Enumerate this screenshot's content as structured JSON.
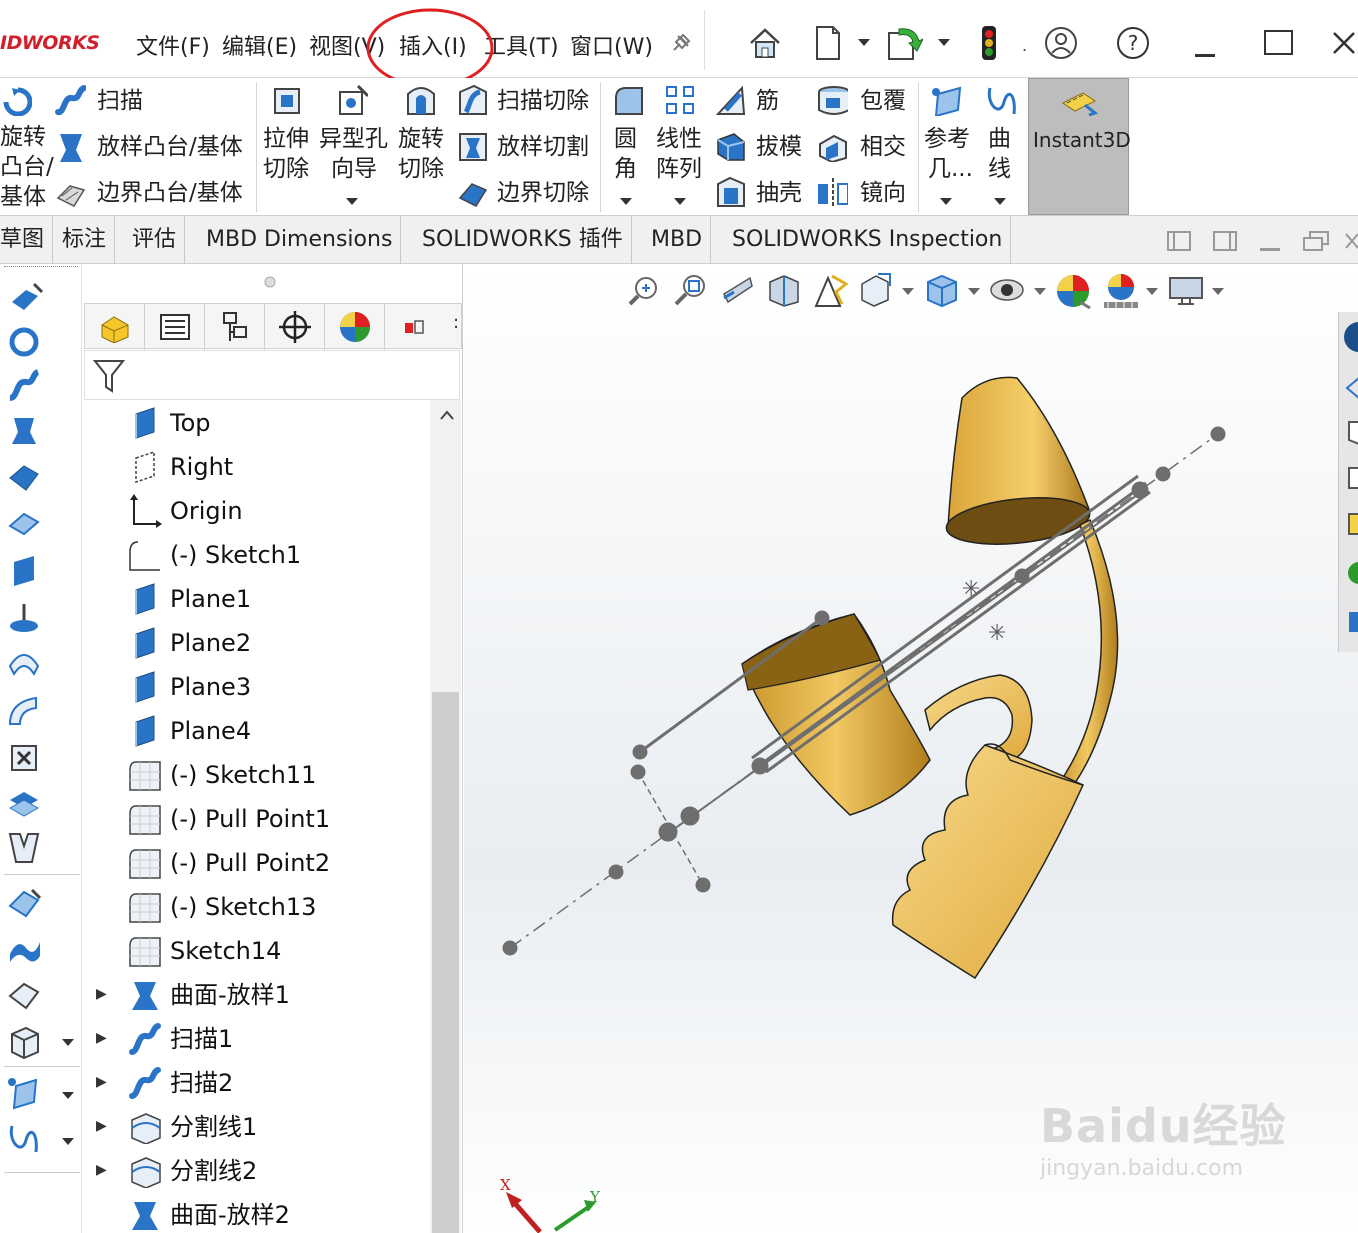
{
  "app": {
    "logo": "IDWORKS"
  },
  "menu": {
    "file": "文件(F)",
    "edit": "编辑(E)",
    "view": "视图(V)",
    "insert": "插入(I)",
    "tools": "工具(T)",
    "window": "窗口(W)"
  },
  "icons": {
    "home": "home-icon",
    "new": "new-document-icon",
    "rebuild": "rebuild-icon",
    "traffic": "traffic-light-icon",
    "user": "user-icon",
    "help": "help-icon",
    "minimize": "minimize-icon",
    "maximize": "maximize-icon",
    "close": "close-icon",
    "pin": "pin-icon"
  },
  "ribbon": {
    "revolve_l1": "旋转",
    "revolve_l2": "凸台/",
    "revolve_l3": "基体",
    "sweep": "扫描",
    "loft": "放样凸台/基体",
    "boundary": "边界凸台/基体",
    "extcut_l1": "拉伸",
    "extcut_l2": "切除",
    "hole_l1": "异型孔",
    "hole_l2": "向导",
    "revcut_l1": "旋转",
    "revcut_l2": "切除",
    "sweepcut": "扫描切除",
    "loftcut": "放样切割",
    "boundcut": "边界切除",
    "fillet_l1": "圆",
    "fillet_l2": "角",
    "pattern_l1": "线性",
    "pattern_l2": "阵列",
    "rib": "筋",
    "draft": "拔模",
    "shell": "抽壳",
    "wrap": "包覆",
    "intersect": "相交",
    "mirror": "镜向",
    "refgeo_l1": "参考",
    "refgeo_l2": "几...",
    "curves_l1": "曲",
    "curves_l2": "线",
    "instant3d": "Instant3D"
  },
  "tabs": [
    "草图",
    "标注",
    "评估",
    "MBD Dimensions",
    "SOLIDWORKS 插件",
    "MBD",
    "SOLIDWORKS Inspection"
  ],
  "tree": [
    {
      "label": "Top",
      "icon": "plane-icon",
      "expand": false
    },
    {
      "label": "Right",
      "icon": "plane-outline-icon",
      "expand": false
    },
    {
      "label": "Origin",
      "icon": "origin-icon",
      "expand": false
    },
    {
      "label": "(-) Sketch1",
      "icon": "sketch-icon",
      "expand": false
    },
    {
      "label": "Plane1",
      "icon": "plane-icon",
      "expand": false
    },
    {
      "label": "Plane2",
      "icon": "plane-icon",
      "expand": false
    },
    {
      "label": "Plane3",
      "icon": "plane-icon",
      "expand": false
    },
    {
      "label": "Plane4",
      "icon": "plane-icon",
      "expand": false
    },
    {
      "label": "(-) Sketch11",
      "icon": "sketch-grid-icon",
      "expand": false
    },
    {
      "label": "(-) Pull Point1",
      "icon": "sketch-grid-icon",
      "expand": false
    },
    {
      "label": "(-) Pull Point2",
      "icon": "sketch-grid-icon",
      "expand": false
    },
    {
      "label": "(-) Sketch13",
      "icon": "sketch-grid-icon",
      "expand": false
    },
    {
      "label": "Sketch14",
      "icon": "sketch-grid-icon",
      "expand": false
    },
    {
      "label": "曲面-放样1",
      "icon": "loft-surface-icon",
      "expand": true
    },
    {
      "label": "扫描1",
      "icon": "sweep-icon",
      "expand": true
    },
    {
      "label": "扫描2",
      "icon": "sweep-icon",
      "expand": true
    },
    {
      "label": "分割线1",
      "icon": "split-line-icon",
      "expand": true
    },
    {
      "label": "分割线2",
      "icon": "split-line-icon",
      "expand": true
    },
    {
      "label": "曲面-放样2",
      "icon": "loft-surface-icon",
      "expand": false
    }
  ],
  "triad": {
    "x": "X",
    "y": "Y"
  },
  "watermark": {
    "line1": "Baidu经验",
    "line2": "jingyan.baidu.com"
  },
  "colors": {
    "accent": "#d0202c",
    "part": "#e8b94a",
    "annotation": "#e02020"
  }
}
